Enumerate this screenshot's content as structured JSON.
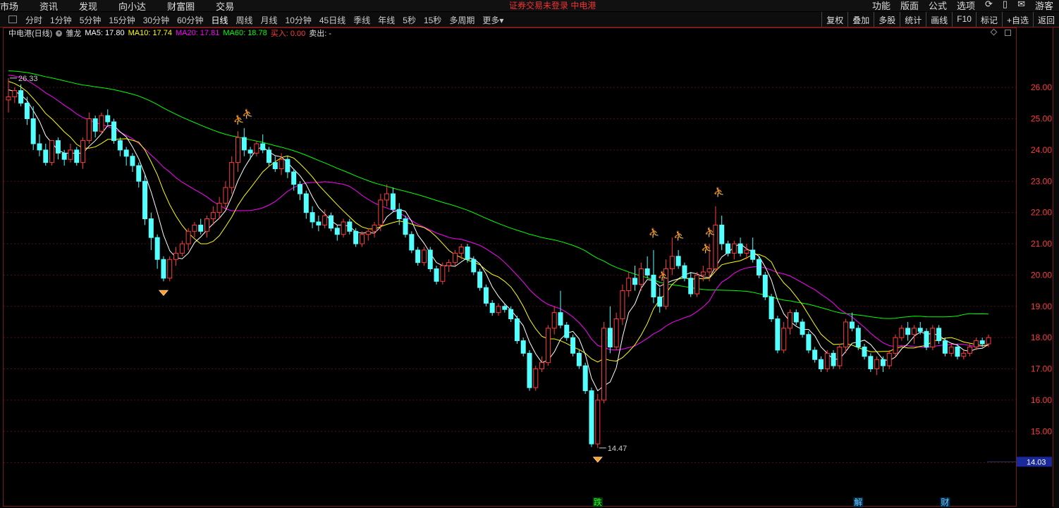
{
  "topbar": {
    "links": [
      "市场",
      "资讯",
      "发现",
      "向小达",
      "财富圈",
      "交易"
    ],
    "warning": "证券交易未登录  中电港",
    "right": [
      "功能",
      "版面",
      "公式",
      "选项",
      "游客"
    ]
  },
  "toolbar": {
    "tabs": [
      "分时",
      "1分钟",
      "5分钟",
      "15分钟",
      "30分钟",
      "60分钟",
      "日线",
      "周线",
      "月线",
      "10分钟",
      "45日线",
      "季线",
      "年线",
      "5秒",
      "15秒",
      "多周期",
      "更多▾"
    ],
    "active_tab": "日线",
    "tools": [
      "复权",
      "叠加",
      "多股",
      "统计",
      "画线",
      "F10",
      "标记",
      "+自选",
      "返回"
    ]
  },
  "info": {
    "stock_name": "中电港(日线)",
    "indicator": "雏龙",
    "ma5": "MA5: 17.80",
    "ma10": "MA10: 17.74",
    "ma20": "MA20: 17.81",
    "ma60": "MA60: 18.78",
    "buy": "买入: 0.00",
    "sell": "卖出: -"
  },
  "colors": {
    "up": "#ff3c3c",
    "down": "#54ffff",
    "ma5": "#ffffff",
    "ma10": "#ffff00",
    "ma20": "#ff00ff",
    "ma60": "#00ff00",
    "frame": "#7a1a1a",
    "axis_text": "#ff3c3c"
  },
  "icons": {
    "runner": "running-man-icon",
    "diamond": "diamond-icon"
  },
  "chart_data": {
    "type": "candlestick",
    "y_ticks": [
      26.0,
      25.0,
      24.0,
      23.0,
      22.0,
      21.0,
      20.0,
      19.0,
      18.0,
      17.0,
      16.0,
      15.0,
      14.0
    ],
    "ylim": [
      13.7,
      27.4
    ],
    "annotations": {
      "high_label": "26.33",
      "low_label": "14.47",
      "current_price": "14.03"
    },
    "markers": [
      "跌",
      "解",
      "财"
    ],
    "candles": [
      [
        25.6,
        26.3,
        25.2,
        25.7
      ],
      [
        25.7,
        26.0,
        25.5,
        25.9
      ],
      [
        25.9,
        26.1,
        25.4,
        25.5
      ],
      [
        25.5,
        25.7,
        24.8,
        25.0
      ],
      [
        25.0,
        25.4,
        24.0,
        24.2
      ],
      [
        24.2,
        24.5,
        23.8,
        24.0
      ],
      [
        24.0,
        24.2,
        23.5,
        23.6
      ],
      [
        23.6,
        24.3,
        23.5,
        24.3
      ],
      [
        24.3,
        24.4,
        23.7,
        23.9
      ],
      [
        23.9,
        24.0,
        23.5,
        23.7
      ],
      [
        23.7,
        24.2,
        23.6,
        24.0
      ],
      [
        24.0,
        24.1,
        23.5,
        23.6
      ],
      [
        23.6,
        24.4,
        23.4,
        24.3
      ],
      [
        24.3,
        25.2,
        24.2,
        25.0
      ],
      [
        25.0,
        25.1,
        24.4,
        24.6
      ],
      [
        24.6,
        25.2,
        24.5,
        25.1
      ],
      [
        25.1,
        25.3,
        24.8,
        24.9
      ],
      [
        24.9,
        25.0,
        24.2,
        24.3
      ],
      [
        24.3,
        24.4,
        23.8,
        24.0
      ],
      [
        24.0,
        24.1,
        23.5,
        23.8
      ],
      [
        23.8,
        23.9,
        23.3,
        23.5
      ],
      [
        23.5,
        23.6,
        22.8,
        23.0
      ],
      [
        23.0,
        23.2,
        21.6,
        21.8
      ],
      [
        21.8,
        22.0,
        20.8,
        21.2
      ],
      [
        21.2,
        21.3,
        20.2,
        20.5
      ],
      [
        20.5,
        20.6,
        19.8,
        19.9
      ],
      [
        19.9,
        20.6,
        19.8,
        20.5
      ],
      [
        20.5,
        20.9,
        20.3,
        20.7
      ],
      [
        20.7,
        21.1,
        20.6,
        21.0
      ],
      [
        21.0,
        21.5,
        20.8,
        21.4
      ],
      [
        21.4,
        21.7,
        21.2,
        21.6
      ],
      [
        21.6,
        21.8,
        21.3,
        21.4
      ],
      [
        21.4,
        21.9,
        21.2,
        21.8
      ],
      [
        21.8,
        22.2,
        21.6,
        22.0
      ],
      [
        22.0,
        22.5,
        21.8,
        22.3
      ],
      [
        22.3,
        23.0,
        22.1,
        22.8
      ],
      [
        22.8,
        23.8,
        22.6,
        23.6
      ],
      [
        23.6,
        24.6,
        23.3,
        24.4
      ],
      [
        24.4,
        24.7,
        23.8,
        24.0
      ],
      [
        24.0,
        24.1,
        23.7,
        23.9
      ],
      [
        23.9,
        24.3,
        23.8,
        24.2
      ],
      [
        24.2,
        24.5,
        23.9,
        24.0
      ],
      [
        24.0,
        24.1,
        23.5,
        23.6
      ],
      [
        23.6,
        23.8,
        23.3,
        23.4
      ],
      [
        23.4,
        23.9,
        23.2,
        23.7
      ],
      [
        23.7,
        23.8,
        23.1,
        23.3
      ],
      [
        23.3,
        23.4,
        22.7,
        22.9
      ],
      [
        22.9,
        23.0,
        22.4,
        22.6
      ],
      [
        22.6,
        22.7,
        21.8,
        22.0
      ],
      [
        22.0,
        22.2,
        21.5,
        21.7
      ],
      [
        21.7,
        21.9,
        21.4,
        21.6
      ],
      [
        21.6,
        22.1,
        21.5,
        21.9
      ],
      [
        21.9,
        22.0,
        21.4,
        21.5
      ],
      [
        21.5,
        21.6,
        21.1,
        21.3
      ],
      [
        21.3,
        21.8,
        21.2,
        21.7
      ],
      [
        21.7,
        21.8,
        21.3,
        21.4
      ],
      [
        21.4,
        21.5,
        20.9,
        21.0
      ],
      [
        21.0,
        21.4,
        20.9,
        21.3
      ],
      [
        21.3,
        21.5,
        21.1,
        21.4
      ],
      [
        21.4,
        21.7,
        21.2,
        21.6
      ],
      [
        21.6,
        22.6,
        21.4,
        22.4
      ],
      [
        22.4,
        22.9,
        22.2,
        22.6
      ],
      [
        22.6,
        22.8,
        22.0,
        22.1
      ],
      [
        22.1,
        22.3,
        21.6,
        21.8
      ],
      [
        21.8,
        21.9,
        21.2,
        21.3
      ],
      [
        21.3,
        21.4,
        20.7,
        20.8
      ],
      [
        20.8,
        20.9,
        20.3,
        20.4
      ],
      [
        20.4,
        20.9,
        20.3,
        20.8
      ],
      [
        20.8,
        20.9,
        20.1,
        20.2
      ],
      [
        20.2,
        20.3,
        19.7,
        19.8
      ],
      [
        19.8,
        20.4,
        19.7,
        20.3
      ],
      [
        20.3,
        20.5,
        20.1,
        20.4
      ],
      [
        20.4,
        20.8,
        20.3,
        20.7
      ],
      [
        20.7,
        21.0,
        20.5,
        20.9
      ],
      [
        20.9,
        21.0,
        20.4,
        20.5
      ],
      [
        20.5,
        20.6,
        20.0,
        20.1
      ],
      [
        20.1,
        20.2,
        19.5,
        19.6
      ],
      [
        19.6,
        19.7,
        19.0,
        19.1
      ],
      [
        19.1,
        19.2,
        18.7,
        18.8
      ],
      [
        18.8,
        19.1,
        18.7,
        19.0
      ],
      [
        19.0,
        19.1,
        18.8,
        18.9
      ],
      [
        18.9,
        19.0,
        18.5,
        18.6
      ],
      [
        18.6,
        18.7,
        17.8,
        17.9
      ],
      [
        17.9,
        18.0,
        17.4,
        17.5
      ],
      [
        17.5,
        17.6,
        16.3,
        16.4
      ],
      [
        16.4,
        17.1,
        16.3,
        17.0
      ],
      [
        17.0,
        17.4,
        16.9,
        17.2
      ],
      [
        17.2,
        18.4,
        17.1,
        18.3
      ],
      [
        18.3,
        19.0,
        18.1,
        18.8
      ],
      [
        18.8,
        19.5,
        18.3,
        18.4
      ],
      [
        18.4,
        18.5,
        17.9,
        18.0
      ],
      [
        18.0,
        18.1,
        17.4,
        17.5
      ],
      [
        17.5,
        17.6,
        17.0,
        17.1
      ],
      [
        17.1,
        17.2,
        16.2,
        16.3
      ],
      [
        16.3,
        16.4,
        14.5,
        14.6
      ],
      [
        14.6,
        16.2,
        14.47,
        16.0
      ],
      [
        16.0,
        18.5,
        15.9,
        18.3
      ],
      [
        18.3,
        19.0,
        17.5,
        17.7
      ],
      [
        17.7,
        18.8,
        17.6,
        18.6
      ],
      [
        18.6,
        19.7,
        18.4,
        19.5
      ],
      [
        19.5,
        20.1,
        19.3,
        19.9
      ],
      [
        19.9,
        20.3,
        19.5,
        19.7
      ],
      [
        19.7,
        20.4,
        19.5,
        20.2
      ],
      [
        20.2,
        20.6,
        19.9,
        20.0
      ],
      [
        20.0,
        20.8,
        19.1,
        19.3
      ],
      [
        19.3,
        19.6,
        18.8,
        19.0
      ],
      [
        19.0,
        20.5,
        18.9,
        20.2
      ],
      [
        20.2,
        21.2,
        20.0,
        20.6
      ],
      [
        20.6,
        20.8,
        20.2,
        20.3
      ],
      [
        20.3,
        20.4,
        19.8,
        19.9
      ],
      [
        19.9,
        20.1,
        19.3,
        19.4
      ],
      [
        19.4,
        20.1,
        19.3,
        20.0
      ],
      [
        20.0,
        20.3,
        19.8,
        20.1
      ],
      [
        20.1,
        21.0,
        19.8,
        20.2
      ],
      [
        20.2,
        22.2,
        20.1,
        21.6
      ],
      [
        21.6,
        21.9,
        20.8,
        21.0
      ],
      [
        21.0,
        21.1,
        20.6,
        20.7
      ],
      [
        20.7,
        21.1,
        20.5,
        21.0
      ],
      [
        21.0,
        21.2,
        20.6,
        20.7
      ],
      [
        20.7,
        21.0,
        20.5,
        20.8
      ],
      [
        20.8,
        21.2,
        20.4,
        20.5
      ],
      [
        20.5,
        20.6,
        19.9,
        20.0
      ],
      [
        20.0,
        20.1,
        19.2,
        19.3
      ],
      [
        19.3,
        19.4,
        18.5,
        18.6
      ],
      [
        18.6,
        18.7,
        17.5,
        17.6
      ],
      [
        17.6,
        18.5,
        17.5,
        18.3
      ],
      [
        18.3,
        18.9,
        18.1,
        18.8
      ],
      [
        18.8,
        18.9,
        18.4,
        18.5
      ],
      [
        18.5,
        18.6,
        18.0,
        18.1
      ],
      [
        18.1,
        18.2,
        17.5,
        17.6
      ],
      [
        17.6,
        17.7,
        17.2,
        17.3
      ],
      [
        17.3,
        17.4,
        16.9,
        17.0
      ],
      [
        17.0,
        17.6,
        16.9,
        17.5
      ],
      [
        17.5,
        17.6,
        17.0,
        17.1
      ],
      [
        17.1,
        17.8,
        17.0,
        17.7
      ],
      [
        17.7,
        18.6,
        17.5,
        18.5
      ],
      [
        18.5,
        18.8,
        18.2,
        18.3
      ],
      [
        18.3,
        18.4,
        17.6,
        17.7
      ],
      [
        17.7,
        17.8,
        17.3,
        17.4
      ],
      [
        17.4,
        17.5,
        16.9,
        17.0
      ],
      [
        17.0,
        17.4,
        16.8,
        17.3
      ],
      [
        17.3,
        17.4,
        16.9,
        17.1
      ],
      [
        17.1,
        17.6,
        17.0,
        17.5
      ],
      [
        17.5,
        18.1,
        17.4,
        18.0
      ],
      [
        18.0,
        18.4,
        17.9,
        18.3
      ],
      [
        18.3,
        18.5,
        17.9,
        18.1
      ],
      [
        18.1,
        18.4,
        17.8,
        18.3
      ],
      [
        18.3,
        18.5,
        18.1,
        18.2
      ],
      [
        18.2,
        18.3,
        17.6,
        17.7
      ],
      [
        17.7,
        18.4,
        17.6,
        18.3
      ],
      [
        18.3,
        18.4,
        17.8,
        17.9
      ],
      [
        17.9,
        18.0,
        17.4,
        17.5
      ],
      [
        17.5,
        17.8,
        17.4,
        17.7
      ],
      [
        17.7,
        17.8,
        17.3,
        17.4
      ],
      [
        17.4,
        17.6,
        17.3,
        17.5
      ],
      [
        17.5,
        17.8,
        17.4,
        17.7
      ],
      [
        17.7,
        18.0,
        17.6,
        17.9
      ],
      [
        17.9,
        18.0,
        17.7,
        17.8
      ],
      [
        17.8,
        18.1,
        17.7,
        18.0
      ]
    ]
  }
}
